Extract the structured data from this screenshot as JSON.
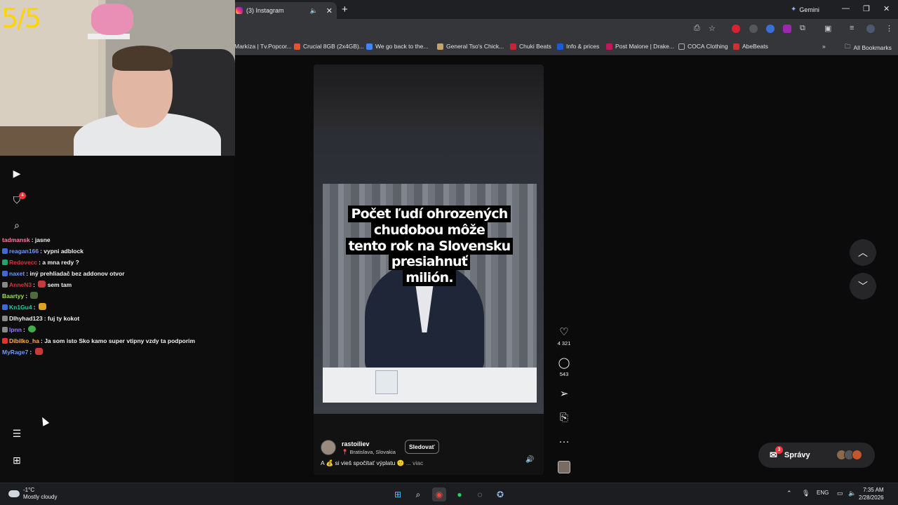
{
  "stream": {
    "counter": "5/5",
    "rail_badge": "4",
    "chat": [
      {
        "user": "tadmansk",
        "user_color": "#ff7aa8",
        "text": "jasne",
        "badge_color": "",
        "emote_color": ""
      },
      {
        "user": "reagan166",
        "user_color": "#6a9bff",
        "text": "vypni adblock",
        "badge_color": "#3b6bd6",
        "emote_color": ""
      },
      {
        "user": "Redovecc",
        "user_color": "#e0333a",
        "text": "a mna redy ?",
        "badge_color": "#21a36b",
        "emote_color": ""
      },
      {
        "user": "naxet",
        "user_color": "#6a9bff",
        "text": "iný prehliadač bez addonov otvor",
        "badge_color": "#3b6bd6",
        "emote_color": ""
      },
      {
        "user": "AnneN3",
        "user_color": "#d2333b",
        "text": "sem tam",
        "badge_color": "#888",
        "emote_color": "#c43b3b"
      },
      {
        "user": "Baartyy",
        "user_color": "#9be34a",
        "text": "",
        "badge_color": "",
        "emote_color": "#4f6b3d"
      },
      {
        "user": "Kn1Gu4",
        "user_color": "#2ec7a0",
        "text": "",
        "badge_color": "#3b6bd6",
        "emote_color": "#e0a020"
      },
      {
        "user": "Dlhyhad123",
        "user_color": "#f0f0f0",
        "text": "fuj ty kokot",
        "badge_color": "#888",
        "emote_color": ""
      },
      {
        "user": "Ipnn",
        "user_color": "#9f7bff",
        "text": "",
        "badge_color": "#888",
        "emote_color": "#3fae49"
      },
      {
        "user": "Dibilko_ha",
        "user_color": "#ffb14a",
        "text": "Ja som isto Sko kamo super vtipny vzdy ta podporim",
        "badge_color": "#d33",
        "emote_color": ""
      },
      {
        "user": "MyRage7",
        "user_color": "#6a9bff",
        "text": "",
        "badge_color": "",
        "emote_color": "#c43b3b"
      }
    ],
    "rail_icons": [
      "play-icon",
      "heart-filter-icon",
      "search-icon",
      "menu-icon",
      "apps-icon"
    ]
  },
  "browser": {
    "tab_title": "(3) Instagram",
    "new_tab": "+",
    "gemini_label": "Gemini",
    "bookmarks": [
      {
        "label": "Markíza | Tv.Popcor...",
        "color": ""
      },
      {
        "label": "Crucial 8GB (2x4GB)...",
        "color": "#e2552b"
      },
      {
        "label": "We go back to the...",
        "color": "#4285f4"
      },
      {
        "label": "General Tso's Chick...",
        "color": "#c9a46a"
      },
      {
        "label": "Chuki Beats",
        "color": "#cc2233"
      },
      {
        "label": "Info & prices",
        "color": "#1a5cd6"
      },
      {
        "label": "Post Malone | Drake...",
        "color": "#c2185b"
      },
      {
        "label": "COCA Clothing",
        "color": "#333"
      },
      {
        "label": "AbeBeats",
        "color": "#d32f2f"
      }
    ],
    "all_bookmarks": "All Bookmarks",
    "overflow": "»"
  },
  "reel": {
    "headline_lines": [
      "Počet ľudí ohrozených chudobou môže",
      "tento rok na Slovensku presiahnuť",
      "milión."
    ],
    "username": "rastoiliev",
    "location": "Bratislava, Slovakia",
    "follow_label": "Sledovať",
    "caption": "A 💰 si vieš spočítať výplatu 🙂",
    "caption_more": "... viac",
    "likes": "4 321",
    "comments": "543"
  },
  "messages": {
    "label": "Správy",
    "badge": "3"
  },
  "taskbar": {
    "temperature": "-1°C",
    "weather": "Mostly cloudy",
    "language": "ENG",
    "time": "7:35 AM",
    "date": "2/28/2026"
  },
  "colors": {
    "accent_red": "#ff3040",
    "counter_yellow": "#ffd400",
    "page_bg": "#0b0b0c"
  }
}
